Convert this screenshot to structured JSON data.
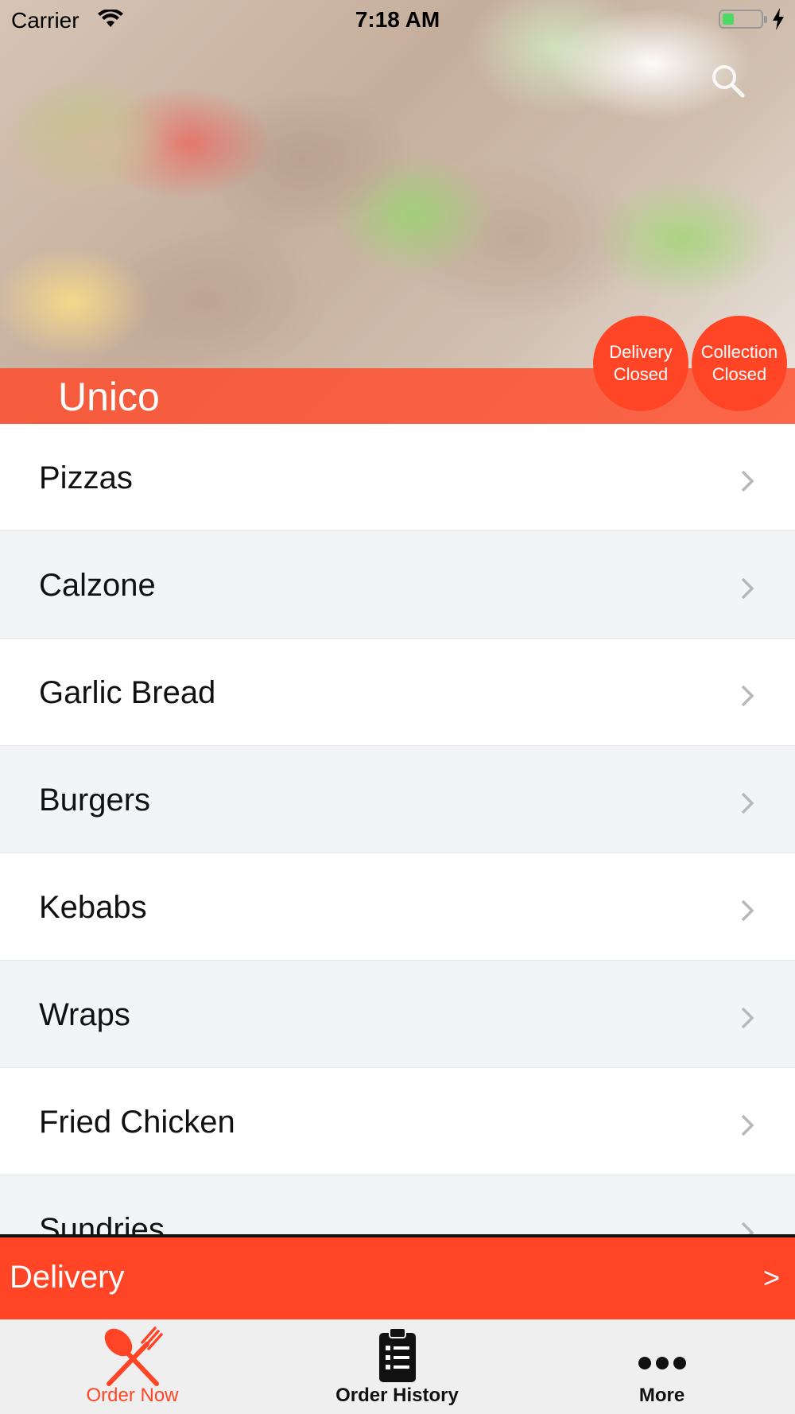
{
  "status_bar": {
    "carrier": "Carrier",
    "time": "7:18 AM"
  },
  "header": {
    "restaurant_name": "Unico",
    "search_icon": "search-icon",
    "badges": {
      "delivery": {
        "line1": "Delivery",
        "line2": "Closed"
      },
      "collection": {
        "line1": "Collection",
        "line2": "Closed"
      }
    }
  },
  "menu": {
    "items": [
      {
        "label": "Pizzas"
      },
      {
        "label": "Calzone"
      },
      {
        "label": "Garlic Bread"
      },
      {
        "label": "Burgers"
      },
      {
        "label": "Kebabs"
      },
      {
        "label": "Wraps"
      },
      {
        "label": "Fried Chicken"
      },
      {
        "label": "Sundries"
      }
    ]
  },
  "delivery_bar": {
    "label": "Delivery",
    "arrow": ">"
  },
  "tab_bar": {
    "tabs": [
      {
        "label": "Order Now",
        "icon": "fork-knife-icon",
        "active": true
      },
      {
        "label": "Order History",
        "icon": "clipboard-list-icon",
        "active": false
      },
      {
        "label": "More",
        "icon": "more-dots-icon",
        "active": false
      }
    ]
  },
  "colors": {
    "accent": "#ff4526",
    "row_alt": "#f3f4f6",
    "tab_bar_bg": "#efefef"
  }
}
